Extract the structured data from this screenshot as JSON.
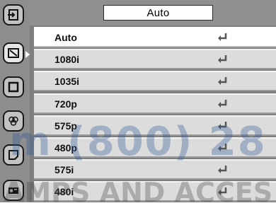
{
  "menu": {
    "current_value": "Auto",
    "items": [
      {
        "label": "Auto",
        "selected": true
      },
      {
        "label": "1080i",
        "selected": false
      },
      {
        "label": "1035i",
        "selected": false
      },
      {
        "label": "720p",
        "selected": false
      },
      {
        "label": "575p",
        "selected": false
      },
      {
        "label": "480p",
        "selected": false
      },
      {
        "label": "575i",
        "selected": false
      },
      {
        "label": "480i",
        "selected": false
      }
    ],
    "item_icon": "enter-return-icon"
  },
  "sidebar": {
    "icons": [
      "input-select-icon",
      "signal-select-icon",
      "screen-size-icon",
      "color-setting-icon",
      "setting-icon",
      "projector-info-icon"
    ],
    "active_index": 1
  },
  "watermark": {
    "line1": "m (800) 28",
    "line2": "AMPS AND ACCES"
  },
  "colors": {
    "panel": "#7f7f7f",
    "row": "#dcdcdc",
    "row_selected": "#ffffff",
    "sidebar": "#8e8e8e",
    "watermark": "#2855a0"
  }
}
